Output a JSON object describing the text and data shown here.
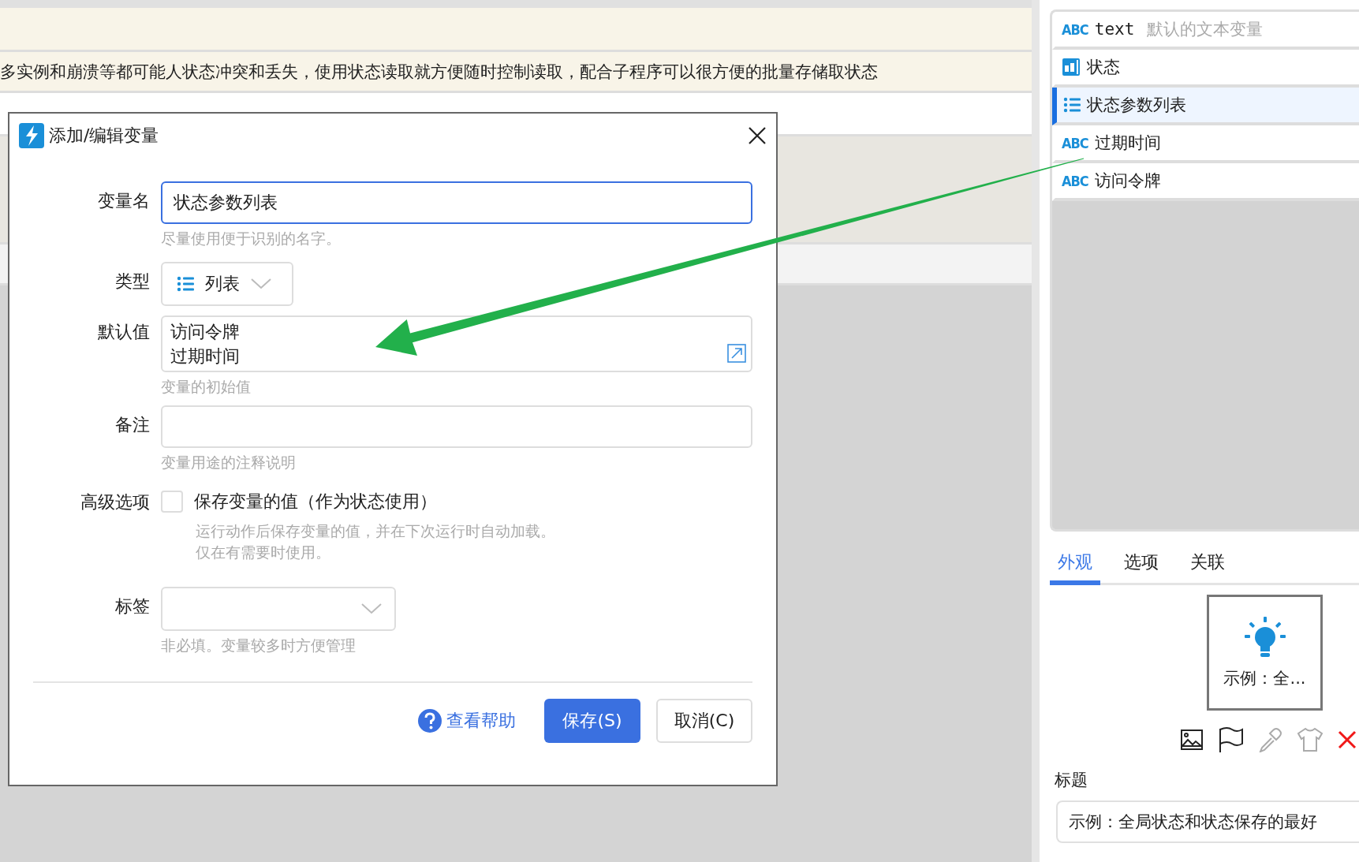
{
  "background": {
    "notice": "多实例和崩溃等都可能人状态冲突和丢失，使用状态读取就方便随时控制读取，配合子程序可以很方便的批量存储取状态"
  },
  "dialog": {
    "title": "添加/编辑变量",
    "name": {
      "label": "变量名",
      "value": "状态参数列表",
      "hint": "尽量使用便于识别的名字。",
      "focused": true
    },
    "type": {
      "label": "类型",
      "value": "列表"
    },
    "default_value": {
      "label": "默认值",
      "lines": [
        "访问令牌",
        "过期时间"
      ],
      "hint": "变量的初始值"
    },
    "note": {
      "label": "备注",
      "hint": "变量用途的注释说明"
    },
    "advanced": {
      "label": "高级选项",
      "option": "保存变量的值（作为状态使用）",
      "checked": false,
      "description": [
        "运行动作后保存变量的值，并在下次运行时自动加载。",
        "仅在有需要时使用。"
      ]
    },
    "tag": {
      "label": "标签",
      "hint": "非必填。变量较多时方便管理"
    },
    "buttons": [
      {
        "kind": "help",
        "label": "查看帮助"
      },
      {
        "kind": "primary",
        "label": "保存(S)"
      },
      {
        "kind": "secondary",
        "label": "取消(C)"
      }
    ]
  },
  "variables": [
    {
      "kind": "text",
      "badge": "ABC",
      "name": "text",
      "description": "默认的文本变量",
      "selected": false
    },
    {
      "kind": "state",
      "name": "状态",
      "selected": false
    },
    {
      "kind": "list",
      "name": "状态参数列表",
      "selected": true
    },
    {
      "kind": "text",
      "badge": "ABC",
      "name": "过期时间",
      "selected": false
    },
    {
      "kind": "text",
      "badge": "ABC",
      "name": "访问令牌",
      "selected": false
    }
  ],
  "tabs": [
    {
      "label": "外观",
      "selected": true
    },
    {
      "label": "选项",
      "selected": false
    },
    {
      "label": "关联",
      "selected": false
    }
  ],
  "preview": {
    "caption": "示例：全..."
  },
  "title_field": {
    "label": "标题",
    "value": "示例：全局状态和状态保存的最好"
  }
}
